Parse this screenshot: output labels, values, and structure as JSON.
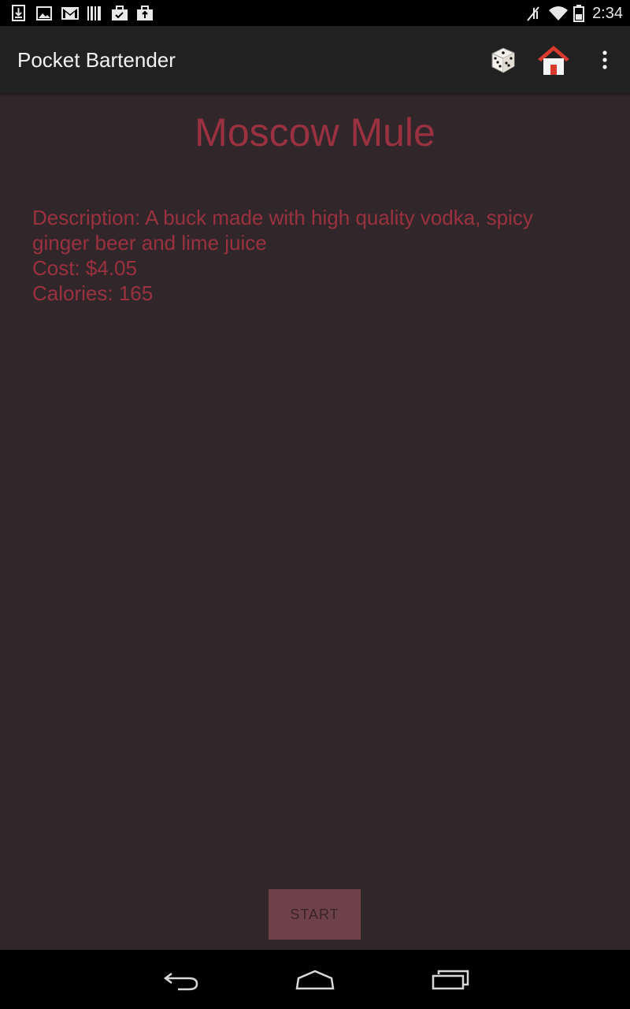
{
  "status_bar": {
    "time": "2:34",
    "left_icons": [
      "download-icon",
      "image-icon",
      "gmail-icon",
      "barcode-icon",
      "briefcase-check-icon",
      "briefcase-upload-icon"
    ],
    "right_icons": [
      "signal-off-icon",
      "wifi-icon",
      "battery-icon"
    ]
  },
  "action_bar": {
    "title": "Pocket Bartender",
    "actions": [
      "dice-icon",
      "home-icon",
      "overflow-menu-icon"
    ]
  },
  "drink": {
    "name": "Moscow Mule",
    "description": "Description: A buck made with high quality vodka, spicy ginger beer and lime juice",
    "cost": "Cost: $4.05",
    "calories": "Calories: 165"
  },
  "start_button": {
    "label": "START"
  },
  "nav_bar": {
    "buttons": [
      "back-icon",
      "home-nav-icon",
      "recents-icon"
    ]
  },
  "colors": {
    "background": "#31272a",
    "accent_text": "#9a3140",
    "action_bar": "#212121",
    "button_bg": "#6e4248"
  }
}
